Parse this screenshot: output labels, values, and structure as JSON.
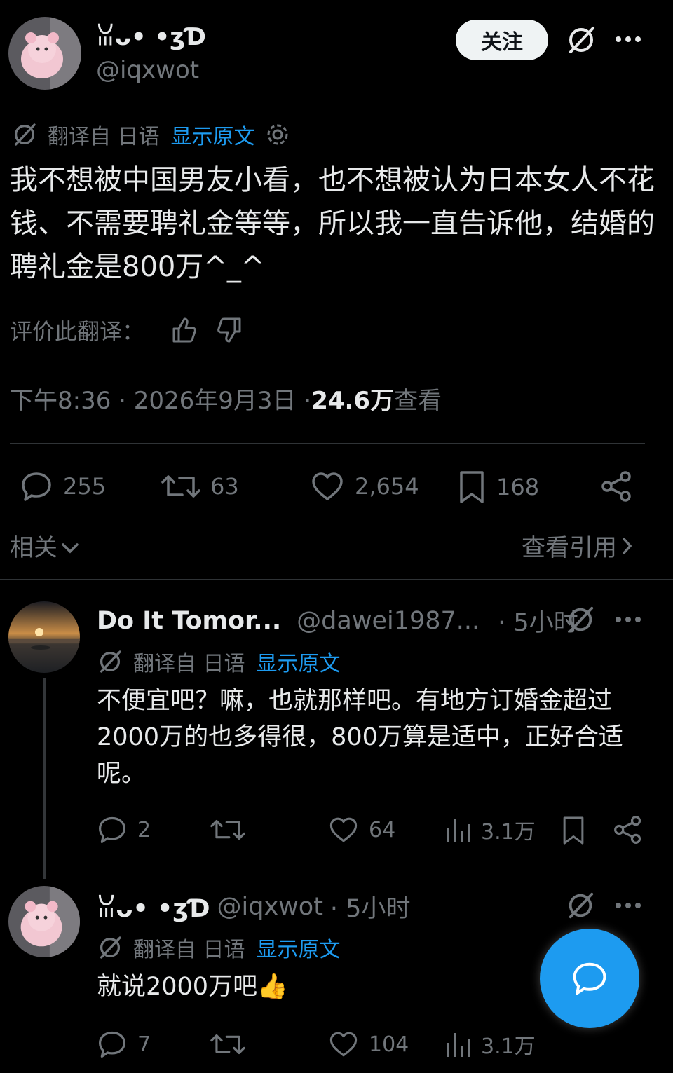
{
  "post": {
    "display_name": "ꈍᴗ•  •ʒƊ",
    "handle": "@iqxwot",
    "follow_label": "关注",
    "translate_label": "翻译自 日语",
    "show_original_label": "显示原文",
    "text": "我不想被中国男友小看，也不想被认为日本女人不花钱、不需要聘礼金等等，所以我一直告诉他，结婚的聘礼金是800万^_^",
    "rate_label": "评价此翻译：",
    "time": "下午8:36 · 2026年9月3日 · ",
    "views_count": "24.6万",
    "views_label": " 查看",
    "stats": {
      "replies": "255",
      "reposts": "63",
      "likes": "2,654",
      "bookmarks": "168"
    },
    "related_label": "相关",
    "quotes_label": "查看引用"
  },
  "reply1": {
    "display_name": "Do It Tomor...",
    "handle": "@dawei1987...",
    "time": "· 5小时",
    "translate_label": "翻译自 日语",
    "show_original_label": "显示原文",
    "text": "不便宜吧？嘛，也就那样吧。有地方订婚金超过2000万的也多得很，800万算是适中，正好合适呢。",
    "stats": {
      "replies": "2",
      "likes": "64",
      "views": "3.1万"
    }
  },
  "reply2": {
    "display_name": "ꈍᴗ•  •ʒƊ",
    "handle": "@iqxwot",
    "time": "· 5小时",
    "translate_label": "翻译自 日语",
    "show_original_label": "显示原文",
    "text": "就说2000万吧👍",
    "stats": {
      "replies": "7",
      "likes": "104",
      "views": "3.1万"
    }
  },
  "colors": {
    "accent": "#1d9bf0",
    "background": "#000000",
    "text": "#e7e9ea",
    "muted": "#71767b"
  },
  "icons": [
    "grok-icon",
    "more-icon",
    "translate-icon",
    "gear-icon",
    "thumbs-up-icon",
    "thumbs-down-icon",
    "reply-icon",
    "repost-icon",
    "like-icon",
    "bookmark-icon",
    "share-icon",
    "views-icon",
    "chevron-down-icon",
    "chevron-right-icon",
    "compose-reply-icon"
  ]
}
